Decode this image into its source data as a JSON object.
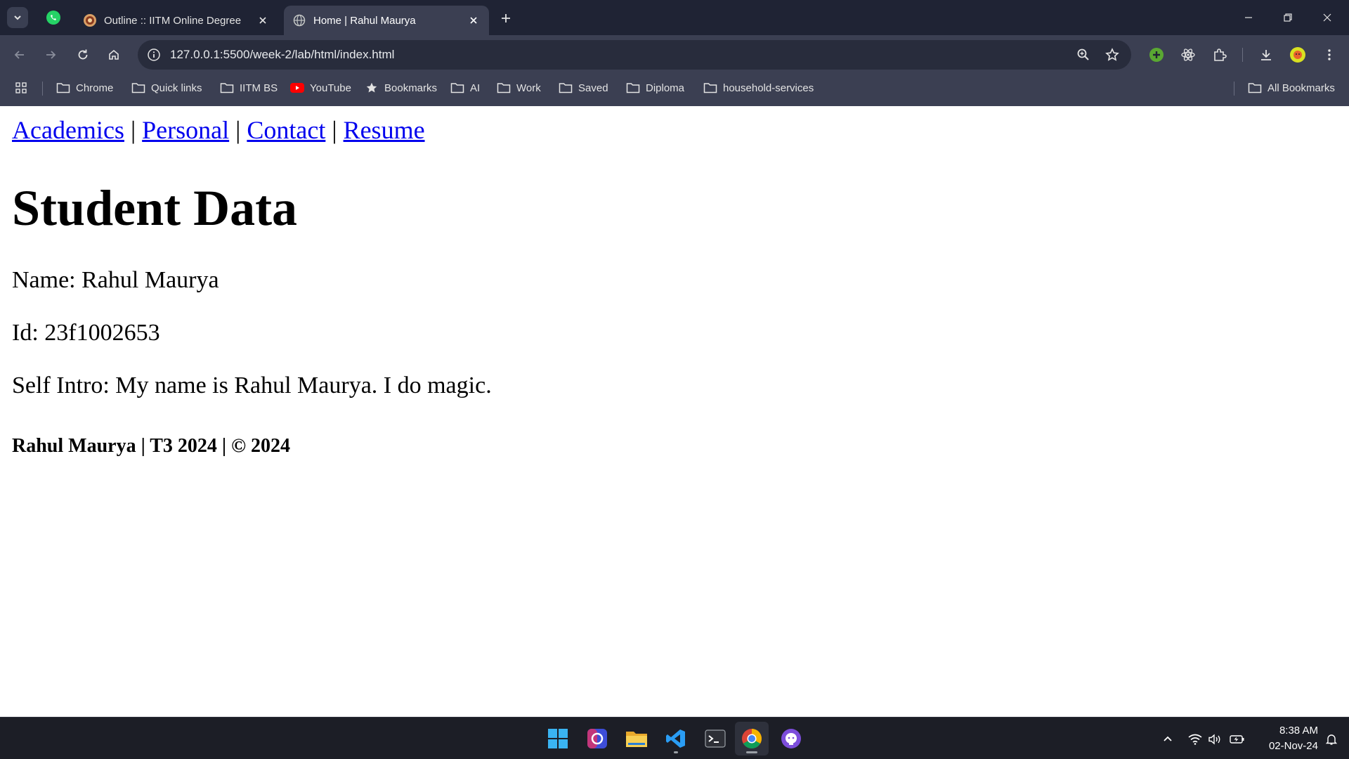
{
  "browser": {
    "tabs": [
      {
        "title": "Outline :: IITM Online Degree",
        "favicon": "iitm-favicon-icon",
        "active": false
      },
      {
        "title": "Home | Rahul Maurya",
        "favicon": "globe-icon",
        "active": true
      }
    ],
    "pinned_tab_icon": "whatsapp-icon",
    "address_bar": {
      "url": "127.0.0.1:5500/week-2/lab/html/index.html"
    },
    "bookmarks": [
      {
        "label": "Chrome",
        "icon": "folder-icon"
      },
      {
        "label": "Quick links",
        "icon": "folder-icon"
      },
      {
        "label": "IITM BS",
        "icon": "folder-icon"
      },
      {
        "label": "YouTube",
        "icon": "youtube-icon"
      },
      {
        "label": "Bookmarks",
        "icon": "star-icon"
      },
      {
        "label": "AI",
        "icon": "folder-icon"
      },
      {
        "label": "Work",
        "icon": "folder-icon"
      },
      {
        "label": "Saved",
        "icon": "folder-icon"
      },
      {
        "label": "Diploma",
        "icon": "folder-icon"
      },
      {
        "label": "household-services",
        "icon": "folder-icon"
      }
    ],
    "all_bookmarks_label": "All Bookmarks"
  },
  "page": {
    "nav": [
      {
        "label": "Academics"
      },
      {
        "label": "Personal"
      },
      {
        "label": "Contact"
      },
      {
        "label": "Resume"
      }
    ],
    "nav_separator": "|",
    "heading": "Student Data",
    "name_line": "Name: Rahul Maurya",
    "id_line": "Id: 23f1002653",
    "intro_line": "Self Intro: My name is Rahul Maurya. I do magic.",
    "footer": "Rahul Maurya | T3 2024 | © 2024"
  },
  "taskbar": {
    "apps": [
      "windows-start-icon",
      "copilot-icon",
      "file-explorer-icon",
      "vscode-icon",
      "terminal-icon",
      "chrome-icon",
      "github-desktop-icon"
    ],
    "time": "8:38 AM",
    "date": "02-Nov-24"
  },
  "colors": {
    "tabstrip_bg": "#1f2334",
    "toolbar_bg": "#3b3f52",
    "link": "#0000ee",
    "taskbar_bg": "#1c1e26"
  }
}
